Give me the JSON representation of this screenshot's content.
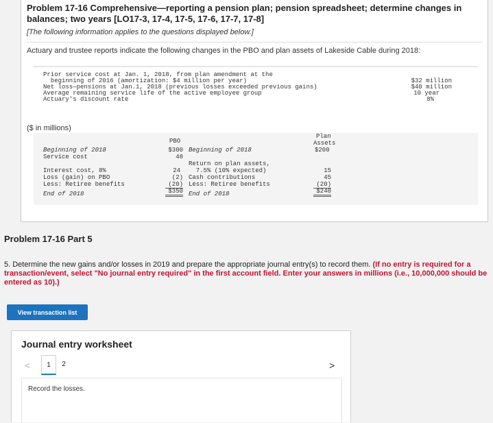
{
  "header": {
    "title": "Problem 17-16 Comprehensive—reporting a pension plan; pension spreadsheet; determine changes in balances; two years [LO17-3, 17-4, 17-5, 17-6, 17-7, 17-8]",
    "note": "[The following information applies to the questions displayed below.]",
    "intro": "Actuary and trustee reports indicate the following changes in the PBO and plan assets of Lakeside Cable during 2018:"
  },
  "facts": {
    "line1": "Prior service cost at Jan. 1, 2018, from plan amendment at the",
    "line2": "  beginning of 2016 (amortization: $4 million per year)",
    "line3": "Net loss—pensions at Jan.1, 2018 (previous losses exceeded previous gains)",
    "line4": "Average remaining service life of the active employee group",
    "line5": "Actuary's discount rate",
    "val1": "$32 million",
    "val2": "$40 million",
    "val3": "10 year",
    "val4": "8%"
  },
  "pbo_table": {
    "unit_label": "($ in millions)",
    "pbo_header": "PBO",
    "assets_header_1": "Plan",
    "assets_header_2": "Assets",
    "assets_header_3": "$200",
    "left": {
      "begin": "Beginning of 2018",
      "service": "Service cost",
      "interest": "Interest cost, 8%",
      "loss": "Loss (gain) on PBO",
      "retiree": "Less: Retiree benefits",
      "end": "End of 2018"
    },
    "pbo_vals": {
      "begin": "$300",
      "service": "48",
      "interest": "24",
      "loss": "(2)",
      "retiree": "(20)",
      "end": "$350"
    },
    "right": {
      "begin": "Beginning of 2018",
      "return1": "Return on plan assets,",
      "return2": "  7.5% (10% expected)",
      "contrib": "Cash contributions",
      "retiree": "Less: Retiree benefits",
      "end": "End of 2018"
    },
    "asset_vals": {
      "return": "15",
      "contrib": "45",
      "retiree": "(20)",
      "end": "$240"
    }
  },
  "part": {
    "title": "Problem 17-16 Part 5",
    "question_plain": "5. Determine the new gains and/or losses in 2019 and prepare the appropriate journal entry(s) to record them.",
    "question_red": "(If no entry is required for a transaction/event, select \"No journal entry required\" in the first account field. Enter your answers in millions (i.e., 10,000,000 should be entered as 10).)"
  },
  "buttons": {
    "view_transaction_list": "View transaction list"
  },
  "worksheet": {
    "title": "Journal entry worksheet",
    "prev": "<",
    "page1": "1",
    "page2": "2",
    "next": ">",
    "instruction": "Record the losses."
  }
}
